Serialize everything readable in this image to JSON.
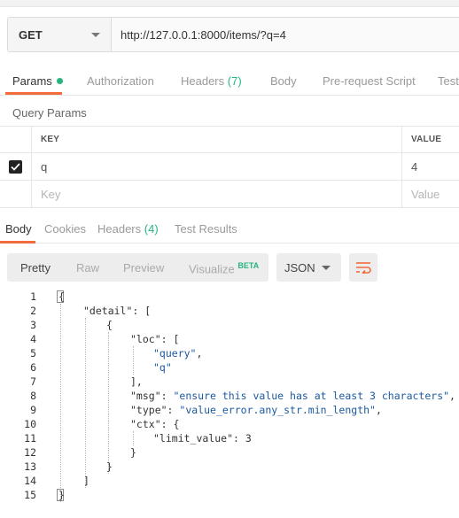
{
  "request": {
    "method": "GET",
    "url": "http://127.0.0.1:8000/items/?q=4"
  },
  "request_tabs": [
    {
      "label": "Params",
      "count": "",
      "active": true
    },
    {
      "label": "Authorization",
      "count": ""
    },
    {
      "label": "Headers",
      "count": "(7)"
    },
    {
      "label": "Body",
      "count": ""
    },
    {
      "label": "Pre-request Script",
      "count": ""
    },
    {
      "label": "Test",
      "count": ""
    }
  ],
  "query_params": {
    "title": "Query Params",
    "headers": {
      "key": "KEY",
      "value": "VALUE"
    },
    "rows": [
      {
        "checked": true,
        "key": "q",
        "value": "4"
      }
    ],
    "placeholder": {
      "key": "Key",
      "value": "Value"
    }
  },
  "response_tabs": [
    {
      "label": "Body",
      "count": "",
      "active": true
    },
    {
      "label": "Cookies",
      "count": ""
    },
    {
      "label": "Headers",
      "count": "(4)"
    },
    {
      "label": "Test Results",
      "count": ""
    }
  ],
  "view_options": {
    "pretty": "Pretty",
    "raw": "Raw",
    "preview": "Preview",
    "visualize": "Visualize",
    "beta": "BETA",
    "format": "JSON",
    "wrap_icon": "wrap-lines-icon"
  },
  "code_lines": [
    {
      "n": "1"
    },
    {
      "n": "2"
    },
    {
      "n": "3"
    },
    {
      "n": "4"
    },
    {
      "n": "5"
    },
    {
      "n": "6"
    },
    {
      "n": "7"
    },
    {
      "n": "8"
    },
    {
      "n": "9"
    },
    {
      "n": "10"
    },
    {
      "n": "11"
    },
    {
      "n": "12"
    },
    {
      "n": "13"
    },
    {
      "n": "14"
    },
    {
      "n": "15"
    }
  ],
  "code": {
    "l2_key": "\"detail\"",
    "l4_key": "\"loc\"",
    "l5_val": "\"query\"",
    "l6_val": "\"q\"",
    "l8_key": "\"msg\"",
    "l8_val": "\"ensure this value has at least 3 characters\"",
    "l9_key": "\"type\"",
    "l9_val": "\"value_error.any_str.min_length\"",
    "l10_key": "\"ctx\"",
    "l11_key": "\"limit_value\"",
    "l11_val": "3"
  },
  "colors": {
    "accent": "#f26b3a",
    "count_green": "#26b47f",
    "string_blue": "#1c5aa0"
  }
}
